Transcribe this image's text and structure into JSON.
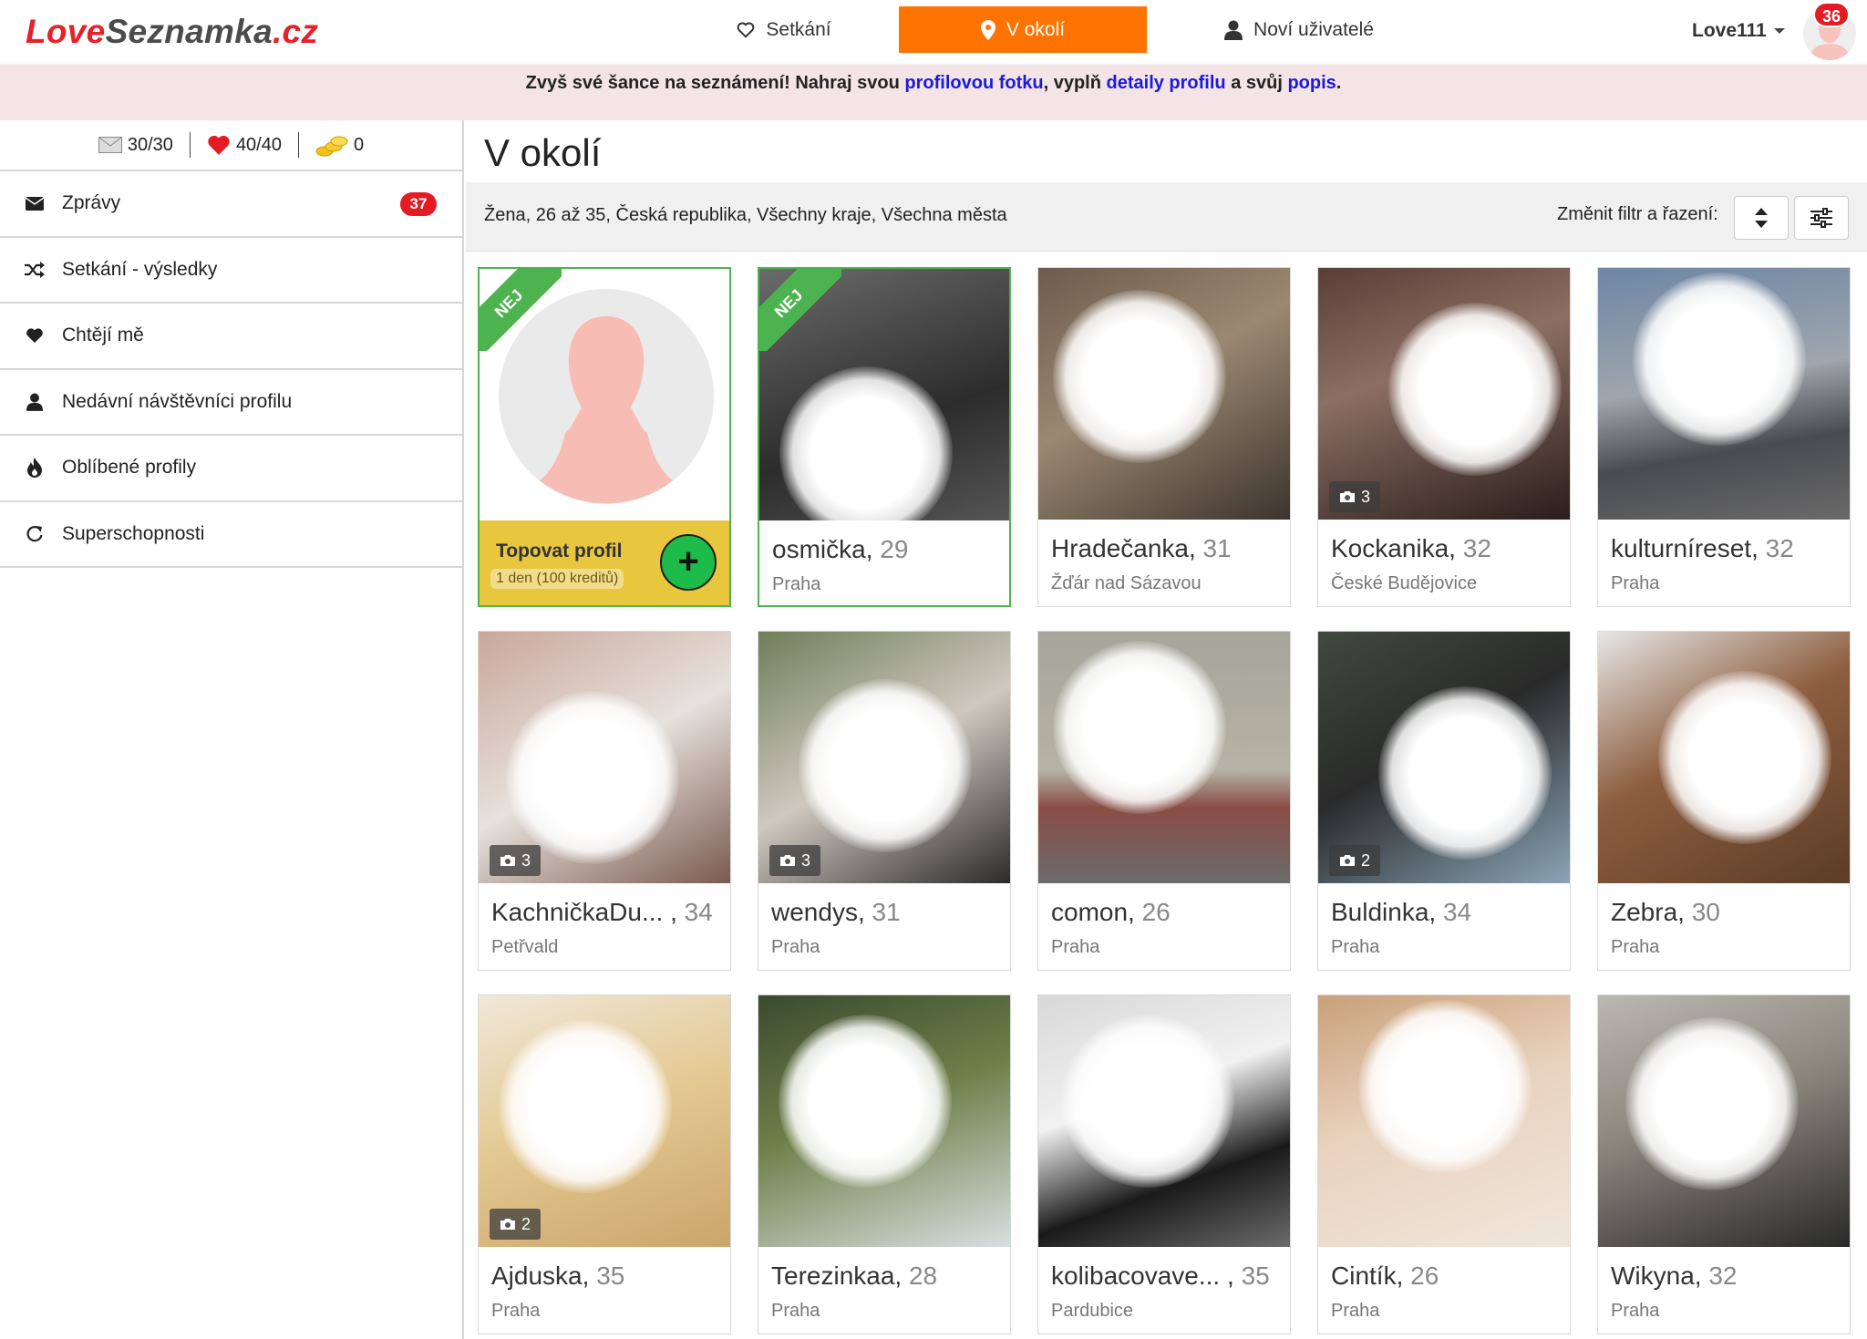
{
  "header": {
    "logo": {
      "part1": "Love",
      "part2": "Seznamka",
      "part3": ".cz"
    },
    "nav": [
      {
        "label": "Setkání",
        "icon": "heart-outline-icon"
      },
      {
        "label": "V okolí",
        "icon": "map-pin-icon",
        "active": true
      },
      {
        "label": "Noví uživatelé",
        "icon": "user-icon"
      }
    ],
    "username": "Love111",
    "notification_count": "36"
  },
  "promo": {
    "prefix": "Zvyš své šance na seznámení! Nahraj svou ",
    "link1": "profilovou fotku",
    "mid1": ", vyplň ",
    "link2": "detaily profilu",
    "mid2": " a svůj ",
    "link3": "popis",
    "suffix": "."
  },
  "sidebar": {
    "stats": [
      {
        "icon": "envelope-icon",
        "value": "30/30"
      },
      {
        "icon": "heart-icon",
        "value": "40/40"
      },
      {
        "icon": "coins-icon",
        "value": "0"
      }
    ],
    "items": [
      {
        "label": "Zprávy",
        "icon": "envelope-icon",
        "badge": "37"
      },
      {
        "label": "Setkání - výsledky",
        "icon": "shuffle-icon"
      },
      {
        "label": "Chtějí mě",
        "icon": "heart-icon"
      },
      {
        "label": "Nedávní návštěvníci profilu",
        "icon": "user-icon"
      },
      {
        "label": "Oblíbené profily",
        "icon": "fire-icon"
      },
      {
        "label": "Superschopnosti",
        "icon": "refresh-icon"
      }
    ]
  },
  "main": {
    "title": "V okolí",
    "filter_summary": "Žena, 26 až 35, Česká republika, Všechny kraje, Všechna města",
    "filter_label": "Změnit filtr a řazení:",
    "top_card": {
      "ribbon": "NEJ",
      "title": "Topovat profil",
      "subtitle": "1 den (100 kreditů)",
      "plus": "+"
    },
    "colors": {
      "accent": "#ff7400",
      "badge": "#e41b23",
      "top_green": "#4cb34e",
      "top_yellow": "#e8c63e"
    },
    "profiles": [
      {
        "name": "osmička,",
        "age": "29",
        "city": "Praha",
        "ribbon": "NEJ"
      },
      {
        "name": "Hradečanka,",
        "age": "31",
        "city": "Žďár nad Sázavou"
      },
      {
        "name": "Kockanika,",
        "age": "32",
        "city": "České Budějovice",
        "photos": "3"
      },
      {
        "name": "kulturníreset,",
        "age": "32",
        "city": "Praha"
      },
      {
        "name": "KachničkaDu... ,",
        "age": "34",
        "city": "Petřvald",
        "photos": "3"
      },
      {
        "name": "wendys,",
        "age": "31",
        "city": "Praha",
        "photos": "3"
      },
      {
        "name": "comon,",
        "age": "26",
        "city": "Praha"
      },
      {
        "name": "Buldinka,",
        "age": "34",
        "city": "Praha",
        "photos": "2"
      },
      {
        "name": "Zebra,",
        "age": "30",
        "city": "Praha"
      },
      {
        "name": "Ajduska,",
        "age": "35",
        "city": "Praha",
        "photos": "2"
      },
      {
        "name": "Terezinkaa,",
        "age": "28",
        "city": "Praha"
      },
      {
        "name": "kolibacovave... ,",
        "age": "35",
        "city": "Pardubice"
      },
      {
        "name": "Cintík,",
        "age": "26",
        "city": "Praha"
      },
      {
        "name": "Wikyna,",
        "age": "32",
        "city": "Praha"
      }
    ]
  }
}
